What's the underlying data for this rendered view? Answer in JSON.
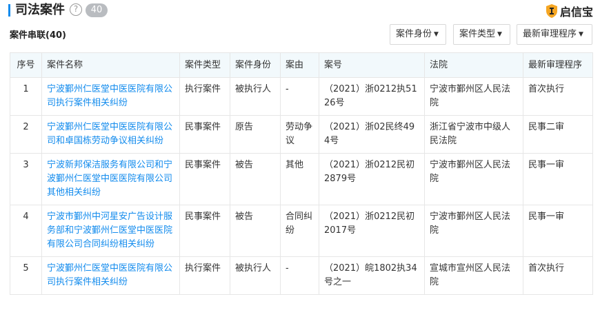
{
  "header": {
    "title": "司法案件",
    "help_glyph": "?",
    "count": "40",
    "brand": "启信宝",
    "brand_color": "#f5a623"
  },
  "section": {
    "title": "案件串联(40)"
  },
  "filters": [
    {
      "label": "案件身份"
    },
    {
      "label": "案件类型"
    },
    {
      "label": "最新审理程序"
    }
  ],
  "table": {
    "columns": [
      "序号",
      "案件名称",
      "案件类型",
      "案件身份",
      "案由",
      "案号",
      "法院",
      "最新审理程序"
    ],
    "rows": [
      {
        "idx": "1",
        "name": "宁波鄞州仁医堂中医医院有限公司执行案件相关纠纷",
        "type": "执行案件",
        "role": "被执行人",
        "cause": "-",
        "case_no": "（2021）浙0212执5126号",
        "court": "宁波市鄞州区人民法院",
        "procedure": "首次执行"
      },
      {
        "idx": "2",
        "name": "宁波鄞州仁医堂中医医院有限公司和卓国栋劳动争议相关纠纷",
        "type": "民事案件",
        "role": "原告",
        "cause": "劳动争议",
        "case_no": "（2021）浙02民终494号",
        "court": "浙江省宁波市中级人民法院",
        "procedure": "民事二审"
      },
      {
        "idx": "3",
        "name": "宁波新邦保洁服务有限公司和宁波鄞州仁医堂中医医院有限公司其他相关纠纷",
        "type": "民事案件",
        "role": "被告",
        "cause": "其他",
        "case_no": "（2021）浙0212民初2879号",
        "court": "宁波市鄞州区人民法院",
        "procedure": "民事一审"
      },
      {
        "idx": "4",
        "name": "宁波市鄞州中河星安广告设计服务部和宁波鄞州仁医堂中医医院有限公司合同纠纷相关纠纷",
        "type": "民事案件",
        "role": "被告",
        "cause": "合同纠纷",
        "case_no": "（2021）浙0212民初2017号",
        "court": "宁波市鄞州区人民法院",
        "procedure": "民事一审"
      },
      {
        "idx": "5",
        "name": "宁波鄞州仁医堂中医医院有限公司执行案件相关纠纷",
        "type": "执行案件",
        "role": "被执行人",
        "cause": "-",
        "case_no": "（2021）皖1802执34号之一",
        "court": "宣城市宣州区人民法院",
        "procedure": "首次执行"
      }
    ]
  }
}
